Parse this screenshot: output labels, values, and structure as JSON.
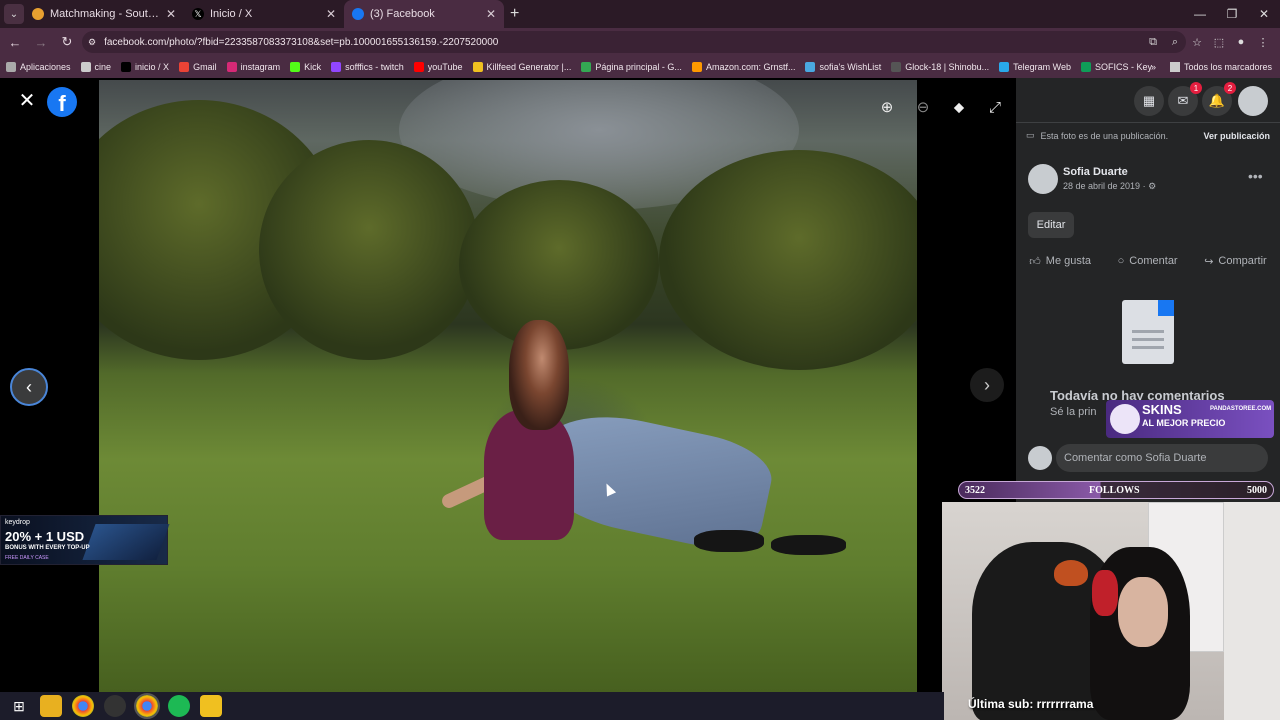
{
  "browser": {
    "tabs": [
      {
        "title": "Matchmaking - South America",
        "active": false
      },
      {
        "title": "Inicio / X",
        "active": false
      },
      {
        "title": "(3) Facebook",
        "active": true
      }
    ],
    "url": "facebook.com/photo/?fbid=2233587083373108&set=pb.100001655136159.-2207520000",
    "bookmarks": [
      "Aplicaciones",
      "cine",
      "inicio / X",
      "Gmail",
      "instagram",
      "Kick",
      "sofffics - twitch",
      "youTube",
      "Killfeed Generator |...",
      "Página principal - G...",
      "Amazon.com: Grnstf...",
      "sofia's WishList",
      "Glock-18 | Shinobu...",
      "Telegram Web",
      "SOFICS - Key"
    ],
    "bookmarks_folder": "Todos los marcadores"
  },
  "viewer": {
    "logo_letter": "f"
  },
  "panel": {
    "messenger_badge": "1",
    "notifications_badge": "2",
    "publication_note": "Esta foto es de una publicación.",
    "view_post": "Ver publicación",
    "author": "Sofia Duarte",
    "date": "28 de abril de 2019 ·",
    "edit": "Editar",
    "like": "Me gusta",
    "comment": "Comentar",
    "share": "Compartir",
    "no_comments_title": "Todavía no hay comentarios",
    "no_comments_sub": "Sé la prin",
    "comment_placeholder": "Comentar como Sofia Duarte"
  },
  "overlays": {
    "keydrop_brand": "keydrop",
    "keydrop_offer": "20% + 1 USD",
    "keydrop_bonus": "BONUS WITH EVERY TOP-UP",
    "keydrop_tag": "FREE DAILY CASE",
    "skins_title": "SKINS",
    "skins_sub": "AL MEJOR PRECIO",
    "skins_site": "PANDASTOREE.COM",
    "follows_current": "3522",
    "follows_label": "FOLLOWS",
    "follows_goal": "5000",
    "last_sub": "Última sub: rrrrrrrama"
  }
}
